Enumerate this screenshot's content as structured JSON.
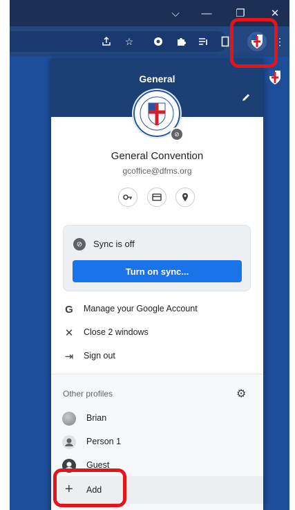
{
  "window_controls": {
    "dropdown": "⌵",
    "minimize": "—",
    "restore": "❐",
    "close": "✕"
  },
  "toolbar_icons": [
    "share-icon",
    "star-icon",
    "extension-icon",
    "puzzle-icon",
    "reading-list-icon",
    "side-panel-icon",
    "profile-icon",
    "menu-icon"
  ],
  "popup": {
    "title": "General",
    "account": {
      "name": "General Convention",
      "email": "gcoffice@dfms.org"
    },
    "quick_buttons": [
      "password-key-icon",
      "payment-card-icon",
      "location-pin-icon"
    ],
    "sync": {
      "status": "Sync is off",
      "button": "Turn on sync..."
    },
    "menu": [
      {
        "icon": "G",
        "label": "Manage your Google Account"
      },
      {
        "icon": "✕",
        "label": "Close 2 windows"
      },
      {
        "icon": "⇥",
        "label": "Sign out"
      }
    ],
    "other_profiles": {
      "title": "Other profiles",
      "items": [
        {
          "label": "Brian"
        },
        {
          "label": "Person 1"
        },
        {
          "label": "Guest"
        }
      ],
      "add_label": "Add"
    }
  },
  "colors": {
    "accent": "#1a73e8",
    "header": "#1c3f76",
    "highlight": "#e4141b"
  }
}
